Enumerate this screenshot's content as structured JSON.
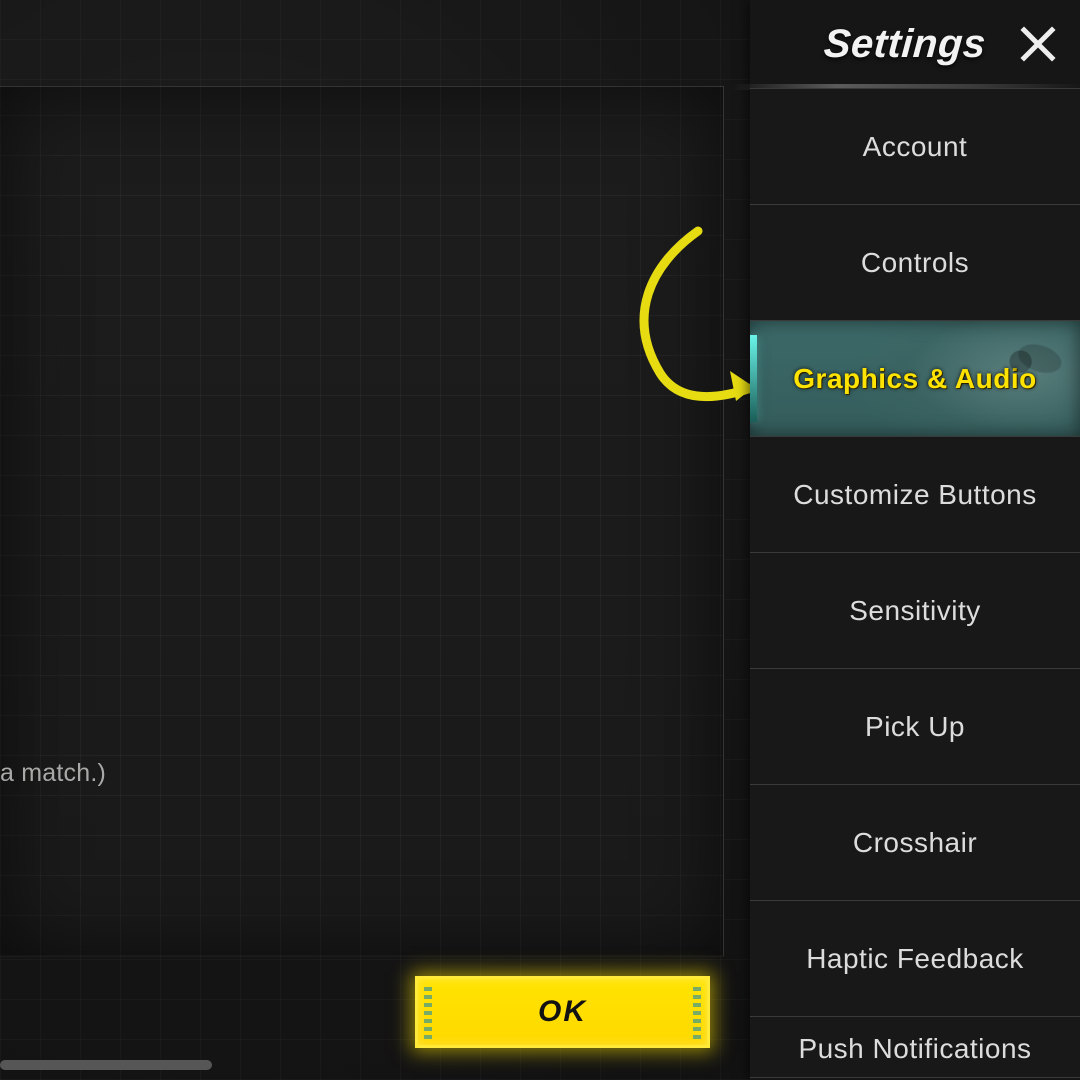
{
  "header": {
    "title": "Settings"
  },
  "sidebar": {
    "items": [
      {
        "label": "Account",
        "active": false
      },
      {
        "label": "Controls",
        "active": false
      },
      {
        "label": "Graphics & Audio",
        "active": true
      },
      {
        "label": "Customize Buttons",
        "active": false
      },
      {
        "label": "Sensitivity",
        "active": false
      },
      {
        "label": "Pick Up",
        "active": false
      },
      {
        "label": "Crosshair",
        "active": false
      },
      {
        "label": "Haptic Feedback",
        "active": false
      },
      {
        "label": "Push Notifications",
        "active": false
      }
    ]
  },
  "main": {
    "hint_fragment": "a match.)",
    "ok_label": "OK"
  },
  "colors": {
    "accent_yellow": "#ffe300",
    "accent_teal": "#3d7271"
  }
}
